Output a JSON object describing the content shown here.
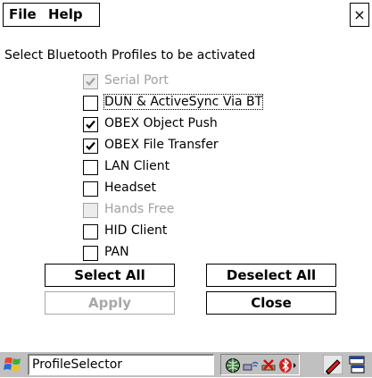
{
  "menu": {
    "file": "File",
    "help": "Help",
    "close": "×"
  },
  "instruction": "Select Bluetooth Profiles to be activated",
  "profiles": [
    {
      "label": "Serial Port",
      "checked": true,
      "enabled": false
    },
    {
      "label": "DUN & ActiveSync Via BT",
      "checked": false,
      "enabled": true,
      "focused": true
    },
    {
      "label": "OBEX Object Push",
      "checked": true,
      "enabled": true
    },
    {
      "label": "OBEX File Transfer",
      "checked": true,
      "enabled": true
    },
    {
      "label": "LAN Client",
      "checked": false,
      "enabled": true
    },
    {
      "label": "Headset",
      "checked": false,
      "enabled": true
    },
    {
      "label": "Hands Free",
      "checked": false,
      "enabled": false
    },
    {
      "label": "HID Client",
      "checked": false,
      "enabled": true
    },
    {
      "label": "PAN",
      "checked": false,
      "enabled": true
    }
  ],
  "buttons": {
    "select_all": "Select All",
    "deselect_all": "Deselect All",
    "apply": "Apply",
    "close": "Close"
  },
  "taskbar": {
    "task_label": "ProfileSelector"
  },
  "icons": {
    "start": "windows-flag-icon",
    "tray": [
      "network-icon",
      "wireless-icon",
      "connection-error-icon",
      "bluetooth-icon"
    ],
    "right": [
      "pen-tool-icon",
      "desktop-icon"
    ]
  }
}
